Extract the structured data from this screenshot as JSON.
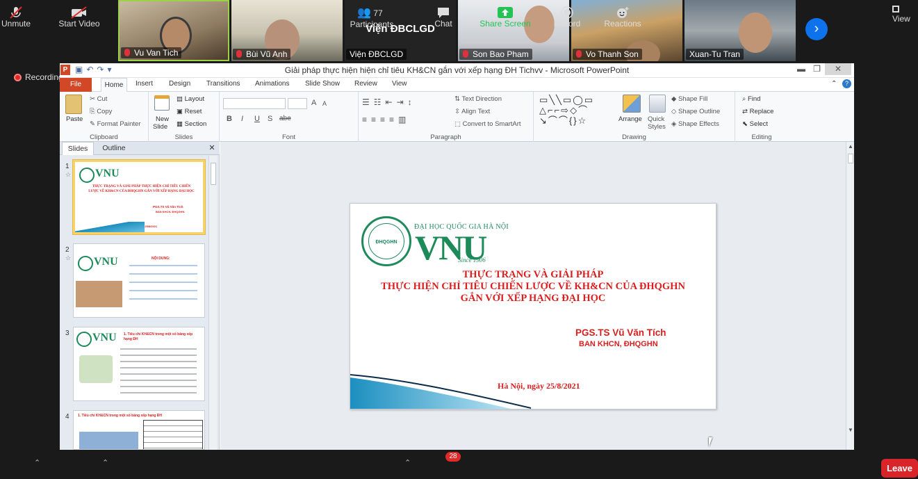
{
  "participants": [
    {
      "name": "Vu Van Tich"
    },
    {
      "name": "Bùi Vũ Anh"
    },
    {
      "name": "Viện ĐBCLGD",
      "display": "Viện ĐBCLGD"
    },
    {
      "name": "Son Bao Pham"
    },
    {
      "name": "Vo Thanh Son"
    },
    {
      "name": "Xuan-Tu Tran"
    }
  ],
  "view_label": "View",
  "recording_label": "Recording",
  "window": {
    "title": "Giải pháp thực hiện hiện chỉ tiêu KH&CN gắn với xếp hạng ĐH Tichvv  -  Microsoft PowerPoint",
    "app_icon": "P"
  },
  "tabs": [
    "File",
    "Home",
    "Insert",
    "Design",
    "Transitions",
    "Animations",
    "Slide Show",
    "Review",
    "View"
  ],
  "ribbon": {
    "clipboard": {
      "label": "Clipboard",
      "paste": "Paste",
      "cut": "Cut",
      "copy": "Copy",
      "format_painter": "Format Painter"
    },
    "slides": {
      "label": "Slides",
      "new_slide_1": "New",
      "new_slide_2": "Slide",
      "layout": "Layout",
      "reset": "Reset",
      "section": "Section"
    },
    "font": {
      "label": "Font",
      "bold": "B",
      "italic": "I",
      "underline": "U",
      "strike": "S",
      "shadow": "abe",
      "grow": "A",
      "shrink": "A"
    },
    "paragraph": {
      "label": "Paragraph",
      "text_direction": "Text Direction",
      "align_text": "Align Text",
      "smartart": "Convert to SmartArt"
    },
    "drawing": {
      "label": "Drawing",
      "arrange": "Arrange",
      "quick_1": "Quick",
      "quick_2": "Styles",
      "shape_fill": "Shape Fill",
      "shape_outline": "Shape Outline",
      "shape_effects": "Shape Effects"
    },
    "editing": {
      "label": "Editing",
      "find": "Find",
      "replace": "Replace",
      "select": "Select"
    }
  },
  "pane": {
    "tabs": [
      "Slides",
      "Outline"
    ],
    "thumbs": [
      {
        "num": "1",
        "title": "THỰC TRẠNG VÀ GIẢI PHÁP THỰC HIỆN CHỈ TIÊU CHIẾN LƯỢC VỀ KH&CN CỦA ĐHQGHN GẮN VỚI XẾP HẠNG ĐẠI HỌC",
        "author": "PGS.TS Vũ Văn Tích",
        "org": "BAN KHCN, ĐHQGHN",
        "date": "Hà Nội, ngày 25/8/2021"
      },
      {
        "num": "2",
        "title": "NỘI DUNG:"
      },
      {
        "num": "3",
        "title": "1. Tiêu chí KH&CN trong một số bảng xếp hạng ĐH"
      },
      {
        "num": "4",
        "title": "1. Tiêu chí KH&CN trong một số bảng xếp hạng ĐH"
      }
    ]
  },
  "slide": {
    "logo_word": "VNU",
    "logo_subtitle": "ĐẠI HỌC QUỐC GIA HÀ NỘI",
    "logo_since": "Since 1906",
    "logo_circle_text": "ĐHQGHN",
    "title_line1": "THỰC TRẠNG VÀ GIẢI PHÁP",
    "title_line2": "THỰC HIỆN CHỈ TIÊU CHIẾN LƯỢC VỀ KH&CN CỦA ĐHQGHN",
    "title_line3": "GẮN VỚI XẾP HẠNG ĐẠI HỌC",
    "author": "PGS.TS Vũ Văn Tích",
    "org": "BAN KHCN, ĐHQGHN",
    "date": "Hà Nội, ngày 25/8/2021"
  },
  "toolbar": {
    "unmute": "Unmute",
    "start_video": "Start Video",
    "participants": "Participants",
    "participant_count": "77",
    "chat": "Chat",
    "chat_badge": "28",
    "share_screen": "Share Screen",
    "record": "Record",
    "reactions": "Reactions",
    "leave": "Leave"
  },
  "colors": {
    "accent_green": "#1d8a5a",
    "title_red": "#d81e1e",
    "file_tab": "#d24726",
    "share_green": "#25c354",
    "leave_red": "#d9252a",
    "zoom_blue": "#0e72ed"
  }
}
